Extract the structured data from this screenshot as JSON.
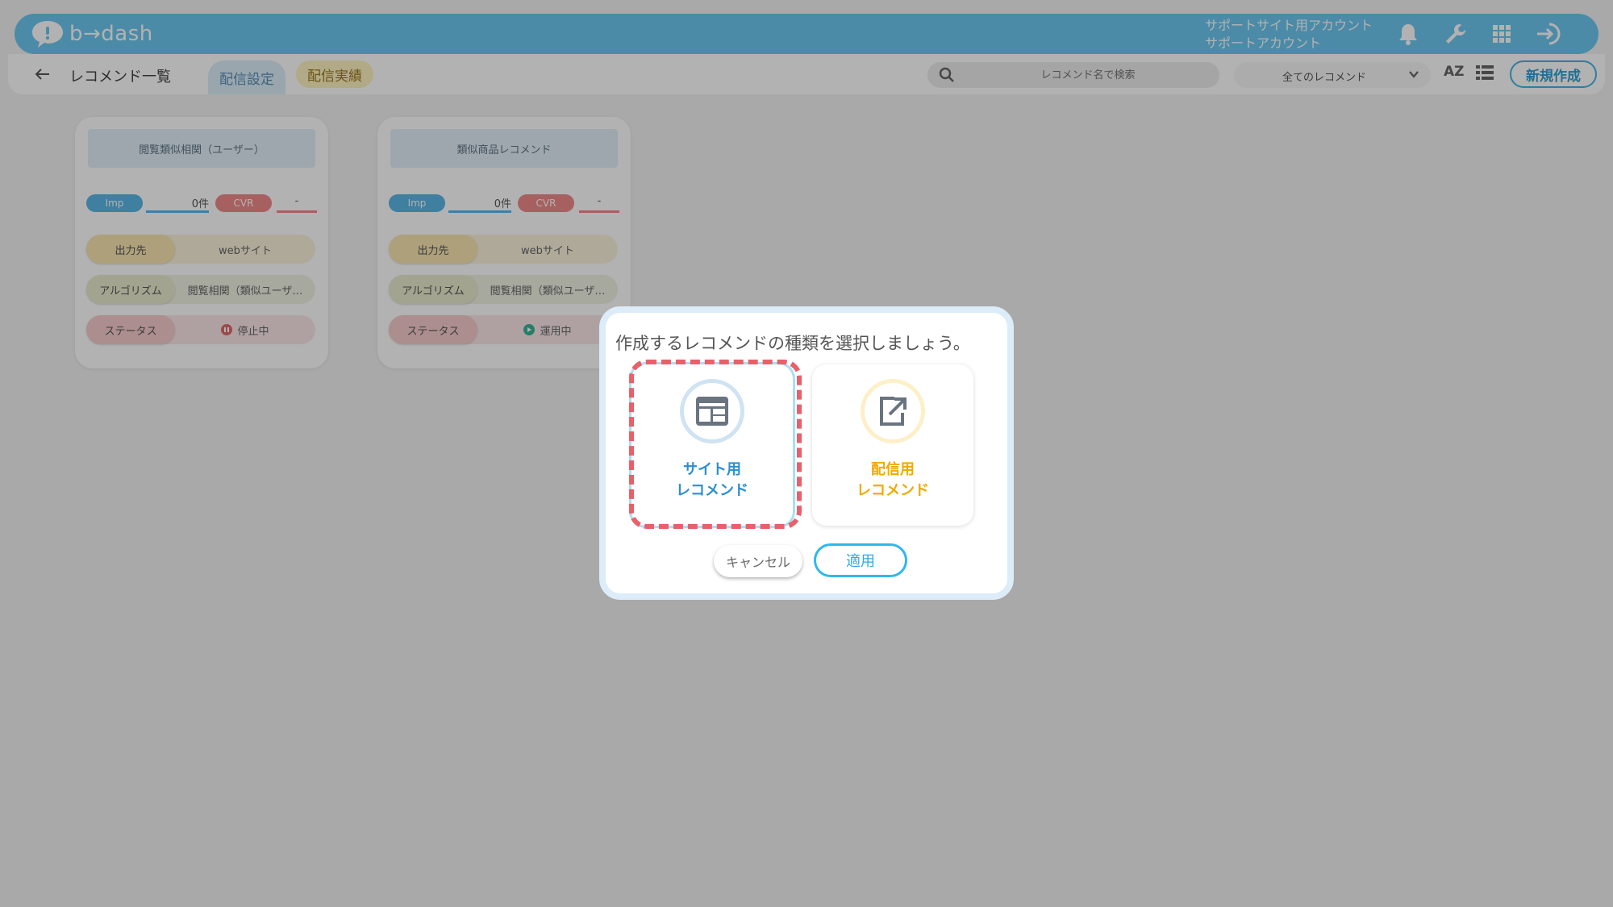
{
  "brand": {
    "logo_text": "b→dash"
  },
  "header": {
    "account_line1": "サポートサイト用アカウント",
    "account_line2": "サポートアカウント",
    "icons": [
      "bell-icon",
      "wrench-icon",
      "apps-grid-icon",
      "logout-icon"
    ]
  },
  "subbar": {
    "page_title": "レコメンド一覧",
    "tabs": [
      {
        "label": "配信設定",
        "active": true
      },
      {
        "label": "配信実績",
        "active": false
      }
    ],
    "search_placeholder": "レコメンド名で検索",
    "filter_selected": "全てのレコメンド",
    "sort_label": "AZ",
    "new_button": "新規作成"
  },
  "cards": [
    {
      "title": "閲覧類似相関（ユーザー）",
      "imp_label": "Imp",
      "imp_value": "0件",
      "cvr_label": "CVR",
      "cvr_value": "-",
      "output_label": "出力先",
      "output_value": "webサイト",
      "algo_label": "アルゴリズム",
      "algo_value": "閲覧相関（類似ユーザ…",
      "status_label": "ステータス",
      "status_value": "停止中"
    },
    {
      "title": "類似商品レコメンド",
      "imp_label": "Imp",
      "imp_value": "0件",
      "cvr_label": "CVR",
      "cvr_value": "-",
      "output_label": "出力先",
      "output_value": "webサイト",
      "algo_label": "アルゴリズム",
      "algo_value": "閲覧相関（類似ユーザ…",
      "status_label": "ステータス",
      "status_value": "運用中"
    }
  ],
  "modal": {
    "title": "作成するレコメンドの種類を選択しましょう。",
    "option_site_line1": "サイト用",
    "option_site_line2": "レコメンド",
    "option_deliv_line1": "配信用",
    "option_deliv_line2": "レコメンド",
    "cancel": "キャンセル",
    "apply": "適用"
  },
  "colors": {
    "brand_blue": "#6ec8ef",
    "imp": "#5bb7e5",
    "cvr": "#ef8a8a",
    "highlight": "#e8606a",
    "stopped": "#e06a6a",
    "running": "#35b596"
  }
}
